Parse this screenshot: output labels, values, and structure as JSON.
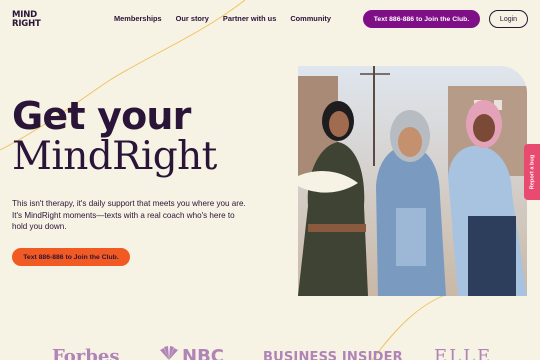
{
  "header": {
    "logo_line1": "MIND",
    "logo_line2": "RIGHT",
    "nav": [
      {
        "label": "Memberships"
      },
      {
        "label": "Our story"
      },
      {
        "label": "Partner with us"
      },
      {
        "label": "Community"
      }
    ],
    "cta_label": "Text 886-886 to Join the Club.",
    "login_label": "Login"
  },
  "hero": {
    "heading_line1": "Get your",
    "heading_line2": "MindRight",
    "body": "This isn't therapy, it's daily support that meets you where you are. It's MindRight moments—texts with a real coach who's here to hold you down.",
    "cta_label": "Text 886-886 to Join the Club."
  },
  "feedback_tab": {
    "label": "Report a bug"
  },
  "press": {
    "logos": [
      "Forbes",
      "NBC",
      "BUSINESS INSIDER",
      "ELLE"
    ]
  },
  "colors": {
    "background": "#f6f2e4",
    "text": "#2a1538",
    "primary_button": "#7e0f86",
    "secondary_button": "#f15a22",
    "report_tab": "#e94a6f",
    "press_logo": "#b084b6",
    "deco_line": "#f0c15a"
  },
  "icons": {
    "nbc": "peacock-icon"
  }
}
